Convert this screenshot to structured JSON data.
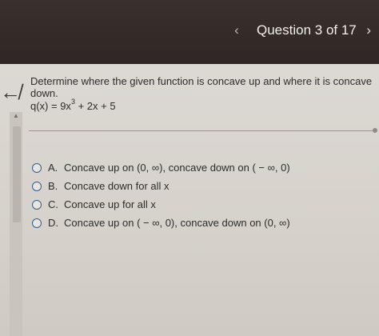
{
  "header": {
    "prev_icon": "chevron-left-icon",
    "prev_glyph": "‹",
    "title": "Question 3 of 17",
    "next_icon": "chevron-right-icon",
    "next_glyph": "›"
  },
  "sidebar": {
    "back_glyph": "↚"
  },
  "question": {
    "prompt": "Determine where the given function is concave up and where it is concave down.",
    "function_lhs": "q(x) = 9x",
    "function_exp": "3",
    "function_rest": " + 2x + 5"
  },
  "options": [
    {
      "letter": "A.",
      "text": "Concave up on (0, ∞), concave down on ( − ∞, 0)"
    },
    {
      "letter": "B.",
      "text": "Concave down for all x"
    },
    {
      "letter": "C.",
      "text": "Concave up for all x"
    },
    {
      "letter": "D.",
      "text": "Concave up on ( − ∞, 0), concave down on (0, ∞)"
    }
  ],
  "colors": {
    "header_bg": "#2f2725",
    "content_bg": "#d9d4cf",
    "radio_border": "#2f5f92"
  }
}
